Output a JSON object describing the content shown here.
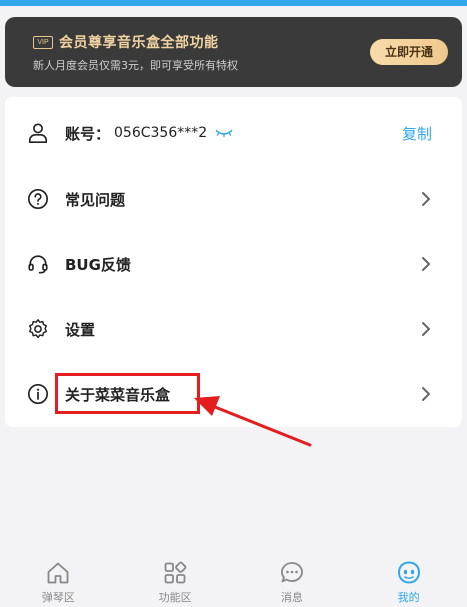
{
  "vip": {
    "badge": "VIP",
    "title": "会员尊享音乐盒全部功能",
    "subtitle": "新人月度会员仅需3元，即可享受所有特权",
    "button": "立即开通"
  },
  "account": {
    "label": "账号：",
    "value": "056C356***2",
    "copy": "复制"
  },
  "menu": {
    "faq": "常见问题",
    "bug": "BUG反馈",
    "settings": "设置",
    "about": "关于菜菜音乐盒"
  },
  "tabs": [
    {
      "label": "弹琴区",
      "icon": "home-icon"
    },
    {
      "label": "功能区",
      "icon": "grid-icon"
    },
    {
      "label": "消息",
      "icon": "chat-icon"
    },
    {
      "label": "我的",
      "icon": "face-icon"
    }
  ],
  "colors": {
    "accent": "#2fa7e8",
    "highlight": "#e41e1e",
    "vip_gold": "#f1d3a1",
    "banner_bg": "#3a3a3a"
  }
}
